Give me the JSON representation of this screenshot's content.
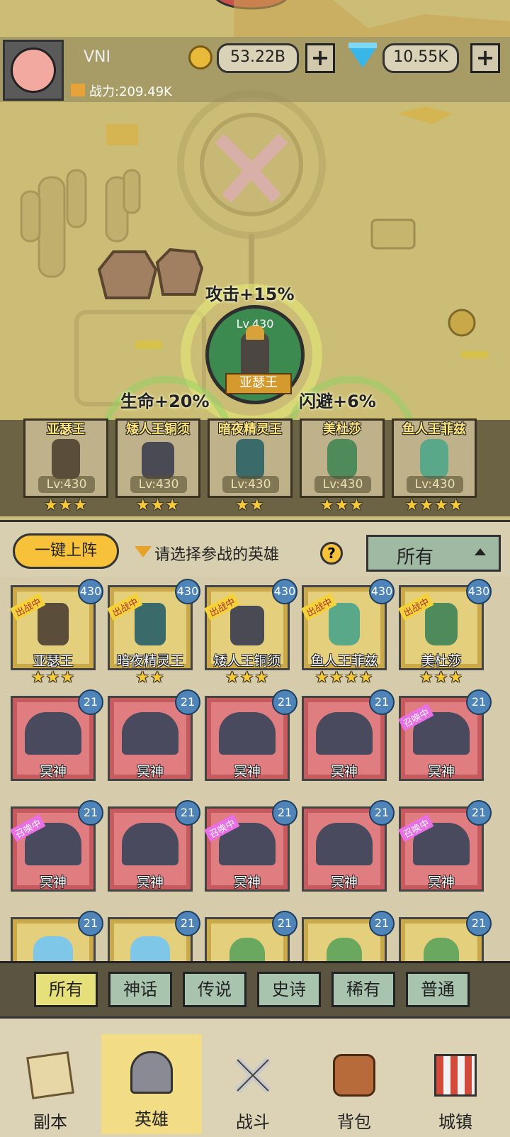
{
  "player": {
    "name": "VNI",
    "power": "战力:209.49K"
  },
  "currency": {
    "gold": "53.22B",
    "gems": "10.55K"
  },
  "team_bonus": {
    "attack": "攻击+15%",
    "life": "生命+20%",
    "dodge": "闪避+6%"
  },
  "leader": {
    "level": "Lv.430",
    "name": "亚瑟王"
  },
  "team": [
    {
      "name": "亚瑟王",
      "level": "Lv:430",
      "stars": "★★★"
    },
    {
      "name": "矮人王铜须",
      "level": "Lv:430",
      "stars": "★★★"
    },
    {
      "name": "暗夜精灵王",
      "level": "Lv:430",
      "stars": "★★"
    },
    {
      "name": "美杜莎",
      "level": "Lv:430",
      "stars": "★★★"
    },
    {
      "name": "鱼人王菲兹",
      "level": "Lv:430",
      "stars": "★★★★"
    }
  ],
  "select_bar": {
    "oneclick": "一键上阵",
    "hint": "请选择参战的英雄",
    "help": "?",
    "filter": "所有"
  },
  "tags": {
    "battle": "出战中",
    "summon": "召唤中"
  },
  "heroes_row1": [
    {
      "name": "亚瑟王",
      "level": "430",
      "stars": "★★★"
    },
    {
      "name": "暗夜精灵王",
      "level": "430",
      "stars": "★★"
    },
    {
      "name": "矮人王铜须",
      "level": "430",
      "stars": "★★★"
    },
    {
      "name": "鱼人王菲兹",
      "level": "430",
      "stars": "★★★★"
    },
    {
      "name": "美杜莎",
      "level": "430",
      "stars": "★★★"
    }
  ],
  "hero_common": {
    "name": "冥神",
    "level": "21"
  },
  "rarity_tabs": [
    "所有",
    "神话",
    "传说",
    "史诗",
    "稀有",
    "普通"
  ],
  "nav": [
    "副本",
    "英雄",
    "战斗",
    "背包",
    "城镇"
  ]
}
